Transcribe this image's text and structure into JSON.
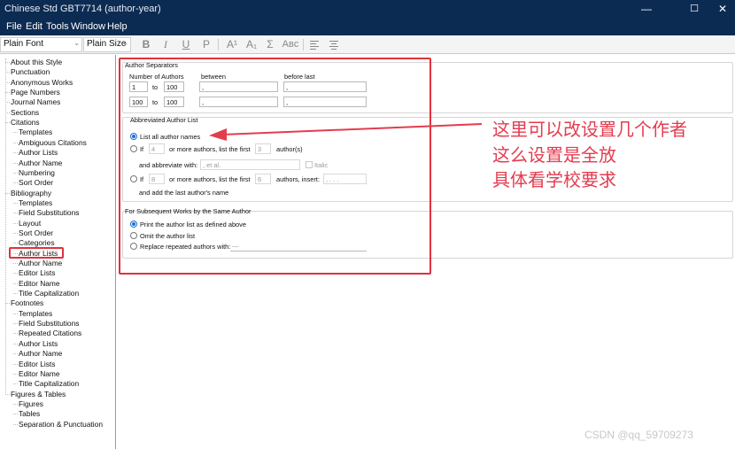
{
  "window": {
    "title": "Chinese Std GBT7714 (author-year)",
    "controls": [
      "—",
      "☐",
      "✕"
    ]
  },
  "menu": [
    "File",
    "Edit",
    "Tools",
    "Window",
    "Help"
  ],
  "toolbar": {
    "font": "Plain Font",
    "size": "Plain Size",
    "format_buttons": [
      "B",
      "I",
      "U",
      "P",
      "A¹",
      "A₁",
      "Σ",
      "Aʙᴄ"
    ],
    "align_icons": [
      "align-left-icon",
      "align-center-icon"
    ]
  },
  "tree": [
    {
      "label": "About this Style",
      "level": 0
    },
    {
      "label": "Punctuation",
      "level": 0
    },
    {
      "label": "Anonymous Works",
      "level": 0
    },
    {
      "label": "Page Numbers",
      "level": 0
    },
    {
      "label": "Journal Names",
      "level": 0
    },
    {
      "label": "Sections",
      "level": 0
    },
    {
      "label": "Citations",
      "level": 0,
      "expanded": true
    },
    {
      "label": "Templates",
      "level": 1
    },
    {
      "label": "Ambiguous Citations",
      "level": 1
    },
    {
      "label": "Author Lists",
      "level": 1
    },
    {
      "label": "Author Name",
      "level": 1
    },
    {
      "label": "Numbering",
      "level": 1
    },
    {
      "label": "Sort Order",
      "level": 1
    },
    {
      "label": "Bibliography",
      "level": 0,
      "expanded": true
    },
    {
      "label": "Templates",
      "level": 1
    },
    {
      "label": "Field Substitutions",
      "level": 1
    },
    {
      "label": "Layout",
      "level": 1
    },
    {
      "label": "Sort Order",
      "level": 1
    },
    {
      "label": "Categories",
      "level": 1
    },
    {
      "label": "Author Lists",
      "level": 1,
      "selected": true
    },
    {
      "label": "Author Name",
      "level": 1
    },
    {
      "label": "Editor Lists",
      "level": 1
    },
    {
      "label": "Editor Name",
      "level": 1
    },
    {
      "label": "Title Capitalization",
      "level": 1
    },
    {
      "label": "Footnotes",
      "level": 0,
      "expanded": true
    },
    {
      "label": "Templates",
      "level": 1
    },
    {
      "label": "Field Substitutions",
      "level": 1
    },
    {
      "label": "Repeated Citations",
      "level": 1
    },
    {
      "label": "Author Lists",
      "level": 1
    },
    {
      "label": "Author Name",
      "level": 1
    },
    {
      "label": "Editor Lists",
      "level": 1
    },
    {
      "label": "Editor Name",
      "level": 1
    },
    {
      "label": "Title Capitalization",
      "level": 1
    },
    {
      "label": "Figures & Tables",
      "level": 0,
      "expanded": true
    },
    {
      "label": "Figures",
      "level": 1
    },
    {
      "label": "Tables",
      "level": 1
    },
    {
      "label": "Separation & Punctuation",
      "level": 1
    }
  ],
  "separators": {
    "heading": "Author Separators",
    "col_count": "Number of Authors",
    "col_between": "between",
    "col_before_last": "before last",
    "to": "to",
    "rows": [
      {
        "from": "1",
        "to": "100",
        "between": ",",
        "before_last": ","
      },
      {
        "from": "100",
        "to": "100",
        "between": ",",
        "before_last": ","
      }
    ]
  },
  "abbrev": {
    "heading": "Abbreviated Author List",
    "list_all": "List all author names",
    "if": "If",
    "opt1_count": "4",
    "opt1_text": "or more authors, list the first",
    "opt1_first": "3",
    "opt1_suffix": "author(s)",
    "abbrev_with_label": "and abbreviate with:",
    "abbrev_with_value": ", et al.",
    "italic": "Italic",
    "opt2_count": "8",
    "opt2_text": "or more authors, list the first",
    "opt2_first": "6",
    "opt2_suffix": "authors, insert:",
    "opt2_insert": ", . . .",
    "opt2_tail": "and add the last author's name"
  },
  "subsequent": {
    "heading": "For Subsequent Works by the Same Author",
    "print": "Print the author list as defined above",
    "omit": "Omit the author list",
    "replace": "Replace repeated authors with:",
    "replace_value": "—"
  },
  "annotation": [
    "这里可以改设置几个作者",
    "这么设置是全放",
    "具体看学校要求"
  ],
  "watermark": "CSDN @qq_59709273",
  "colors": {
    "titlebar": "#0c2b52",
    "highlight": "#e0313d",
    "annotation": "#e33c4f",
    "radio": "#1a6fd0"
  }
}
